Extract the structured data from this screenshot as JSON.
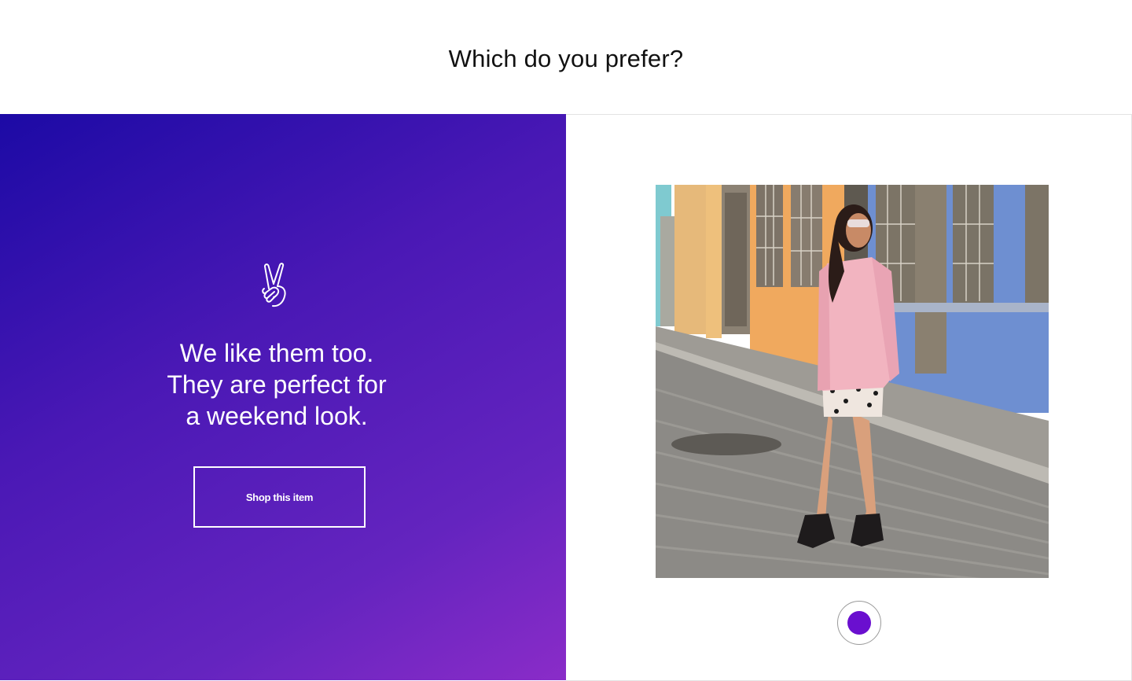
{
  "header": {
    "title": "Which do you prefer?"
  },
  "left_panel": {
    "icon": "peace-hand-icon",
    "message_lines": [
      "We like them too.",
      "They are perfect for",
      "a weekend look."
    ],
    "button_label": "Shop this item",
    "gradient_colors": [
      "#1c0aa5",
      "#8a2cc8"
    ]
  },
  "right_panel": {
    "image": "photo-woman-pink-jacket-cobblestone-street",
    "selected": true,
    "accent_color": "#6a0fcf"
  }
}
